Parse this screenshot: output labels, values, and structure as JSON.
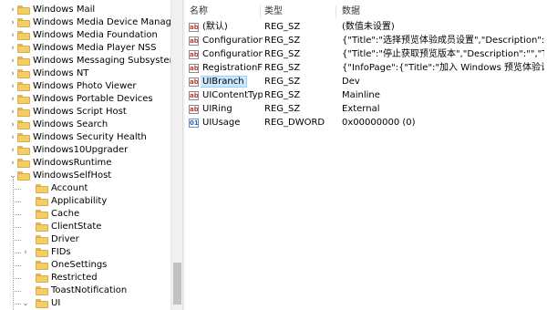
{
  "tree": {
    "items": [
      {
        "label": "Windows Mail",
        "level": 1,
        "expander": "collapsed"
      },
      {
        "label": "Windows Media Device Manager",
        "level": 1,
        "expander": "collapsed"
      },
      {
        "label": "Windows Media Foundation",
        "level": 1,
        "expander": "collapsed"
      },
      {
        "label": "Windows Media Player NSS",
        "level": 1,
        "expander": "collapsed"
      },
      {
        "label": "Windows Messaging Subsystem",
        "level": 1,
        "expander": "collapsed"
      },
      {
        "label": "Windows NT",
        "level": 1,
        "expander": "collapsed"
      },
      {
        "label": "Windows Photo Viewer",
        "level": 1,
        "expander": "collapsed"
      },
      {
        "label": "Windows Portable Devices",
        "level": 1,
        "expander": "collapsed"
      },
      {
        "label": "Windows Script Host",
        "level": 1,
        "expander": "collapsed"
      },
      {
        "label": "Windows Search",
        "level": 1,
        "expander": "collapsed"
      },
      {
        "label": "Windows Security Health",
        "level": 1,
        "expander": "collapsed"
      },
      {
        "label": "Windows10Upgrader",
        "level": 1,
        "expander": "collapsed"
      },
      {
        "label": "WindowsRuntime",
        "level": 1,
        "expander": "collapsed"
      },
      {
        "label": "WindowsSelfHost",
        "level": 1,
        "expander": "expanded"
      },
      {
        "label": "Account",
        "level": 2,
        "expander": "none"
      },
      {
        "label": "Applicability",
        "level": 2,
        "expander": "none"
      },
      {
        "label": "Cache",
        "level": 2,
        "expander": "none"
      },
      {
        "label": "ClientState",
        "level": 2,
        "expander": "none"
      },
      {
        "label": "Driver",
        "level": 2,
        "expander": "none"
      },
      {
        "label": "FIDs",
        "level": 2,
        "expander": "collapsed"
      },
      {
        "label": "OneSettings",
        "level": 2,
        "expander": "none"
      },
      {
        "label": "Restricted",
        "level": 2,
        "expander": "none"
      },
      {
        "label": "ToastNotification",
        "level": 2,
        "expander": "none"
      },
      {
        "label": "UI",
        "level": 2,
        "expander": "expanded"
      }
    ],
    "chevron_collapsed": "›",
    "chevron_expanded": "⌄"
  },
  "list": {
    "columns": {
      "name": "名称",
      "type": "类型",
      "data": "数据"
    },
    "rows": [
      {
        "name": "(默认)",
        "type": "REG_SZ",
        "data": "(数值未设置)",
        "icon": "string-value-icon",
        "badge": "ab",
        "selected": false
      },
      {
        "name": "ConfigurationB...",
        "type": "REG_SZ",
        "data": "{\"Title\":\"选择预览体验成员设置\",\"Description\":\"...",
        "icon": "string-value-icon",
        "badge": "ab",
        "selected": false
      },
      {
        "name": "Configuration...",
        "type": "REG_SZ",
        "data": "{\"Title\":\"停止获取预览版本\",\"Description\":\"\",\"To...",
        "icon": "string-value-icon",
        "badge": "ab",
        "selected": false
      },
      {
        "name": "RegistrationFlow",
        "type": "REG_SZ",
        "data": "{\"InfoPage\":{\"Title\":\"加入 Windows 预览体验计...",
        "icon": "string-value-icon",
        "badge": "ab",
        "selected": false
      },
      {
        "name": "UIBranch",
        "type": "REG_SZ",
        "data": "Dev",
        "icon": "string-value-icon",
        "badge": "ab",
        "selected": true
      },
      {
        "name": "UIContentType",
        "type": "REG_SZ",
        "data": "Mainline",
        "icon": "string-value-icon",
        "badge": "ab",
        "selected": false
      },
      {
        "name": "UIRing",
        "type": "REG_SZ",
        "data": "External",
        "icon": "string-value-icon",
        "badge": "ab",
        "selected": false
      },
      {
        "name": "UIUsage",
        "type": "REG_DWORD",
        "data": "0x00000000 (0)",
        "icon": "dword-value-icon",
        "badge": "011",
        "selected": false
      }
    ]
  },
  "colors": {
    "selection": "#cce8ff",
    "folder": "#f4cd66",
    "string_icon": "#c03a2b",
    "dword_icon": "#2f5fb5"
  }
}
